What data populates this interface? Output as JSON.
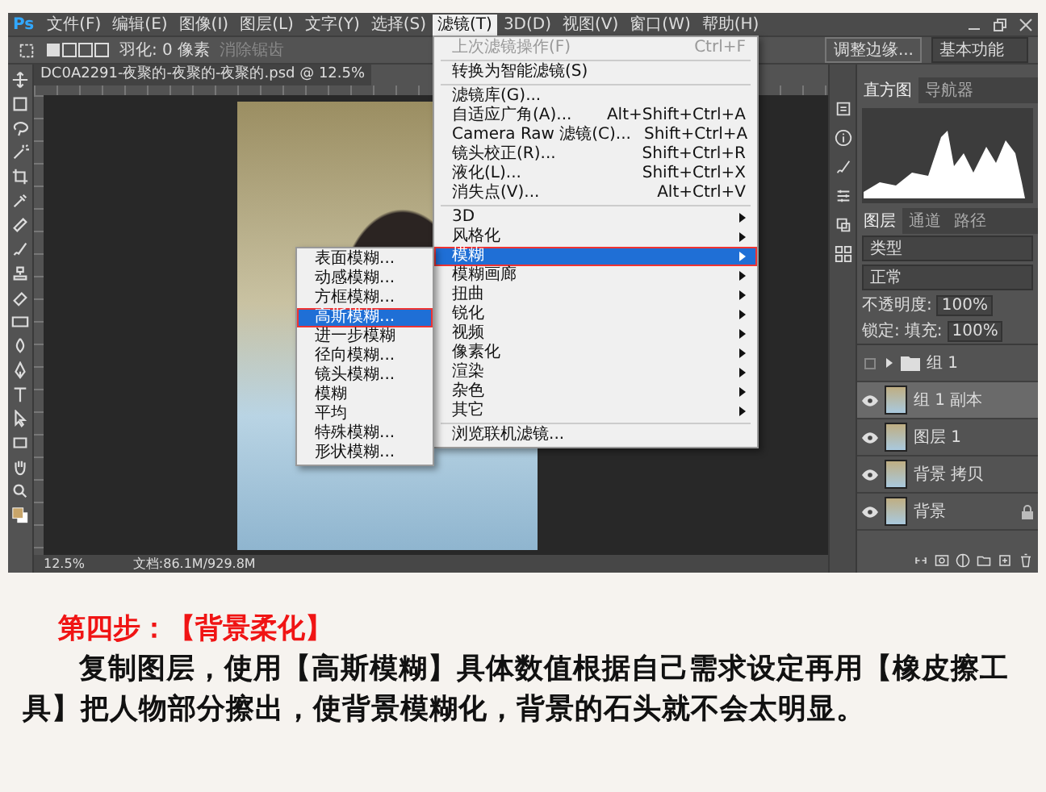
{
  "menu_bar": {
    "logo": "Ps",
    "items": [
      {
        "label": "文件(F)",
        "selected": false
      },
      {
        "label": "编辑(E)",
        "selected": false
      },
      {
        "label": "图像(I)",
        "selected": false
      },
      {
        "label": "图层(L)",
        "selected": false
      },
      {
        "label": "文字(Y)",
        "selected": false
      },
      {
        "label": "选择(S)",
        "selected": false
      },
      {
        "label": "滤镜(T)",
        "selected": true
      },
      {
        "label": "3D(D)",
        "selected": false
      },
      {
        "label": "视图(V)",
        "selected": false
      },
      {
        "label": "窗口(W)",
        "selected": false
      },
      {
        "label": "帮助(H)",
        "selected": false
      }
    ]
  },
  "options_bar": {
    "feather": "羽化: 0 像素",
    "antialias": {
      "label": "消除锯齿",
      "disabled": true
    },
    "refine_edge": "调整边缘...",
    "workspace": "基本功能"
  },
  "document_tab": {
    "title": "DC0A2291-夜聚的-夜聚的-夜聚的.psd @ 12.5%"
  },
  "filter_menu": {
    "sections": [
      [
        {
          "label": "上次滤镜操作(F)",
          "shortcut": "Ctrl+F",
          "submenu": false,
          "disabled": true,
          "selected": false
        }
      ],
      [
        {
          "label": "转换为智能滤镜(S)",
          "submenu": false,
          "disabled": false,
          "selected": false
        }
      ],
      [
        {
          "label": "滤镜库(G)...",
          "submenu": false,
          "disabled": false,
          "selected": false
        },
        {
          "label": "自适应广角(A)...",
          "shortcut": "Alt+Shift+Ctrl+A",
          "submenu": false,
          "disabled": false,
          "selected": false
        },
        {
          "label": "Camera Raw 滤镜(C)...",
          "shortcut": "Shift+Ctrl+A",
          "submenu": false,
          "disabled": false,
          "selected": false
        },
        {
          "label": "镜头校正(R)...",
          "shortcut": "Shift+Ctrl+R",
          "submenu": false,
          "disabled": false,
          "selected": false
        },
        {
          "label": "液化(L)...",
          "shortcut": "Shift+Ctrl+X",
          "submenu": false,
          "disabled": false,
          "selected": false
        },
        {
          "label": "消失点(V)...",
          "shortcut": "Alt+Ctrl+V",
          "submenu": false,
          "disabled": false,
          "selected": false
        }
      ],
      [
        {
          "label": "3D",
          "submenu": true,
          "disabled": false,
          "selected": false
        },
        {
          "label": "风格化",
          "submenu": true,
          "disabled": false,
          "selected": false
        },
        {
          "label": "模糊",
          "submenu": true,
          "disabled": false,
          "selected": true
        },
        {
          "label": "模糊画廊",
          "submenu": true,
          "disabled": false,
          "selected": false
        },
        {
          "label": "扭曲",
          "submenu": true,
          "disabled": false,
          "selected": false
        },
        {
          "label": "锐化",
          "submenu": true,
          "disabled": false,
          "selected": false
        },
        {
          "label": "视频",
          "submenu": true,
          "disabled": false,
          "selected": false
        },
        {
          "label": "像素化",
          "submenu": true,
          "disabled": false,
          "selected": false
        },
        {
          "label": "渲染",
          "submenu": true,
          "disabled": false,
          "selected": false
        },
        {
          "label": "杂色",
          "submenu": true,
          "disabled": false,
          "selected": false
        },
        {
          "label": "其它",
          "submenu": true,
          "disabled": false,
          "selected": false
        }
      ],
      [
        {
          "label": "浏览联机滤镜...",
          "submenu": false,
          "disabled": false,
          "selected": false
        }
      ]
    ]
  },
  "blur_submenu": {
    "items": [
      {
        "label": "表面模糊...",
        "selected": false
      },
      {
        "label": "动感模糊...",
        "selected": false
      },
      {
        "label": "方框模糊...",
        "selected": false
      },
      {
        "label": "高斯模糊...",
        "selected": true
      },
      {
        "label": "进一步模糊",
        "selected": false
      },
      {
        "label": "径向模糊...",
        "selected": false
      },
      {
        "label": "镜头模糊...",
        "selected": false
      },
      {
        "label": "模糊",
        "selected": false
      },
      {
        "label": "平均",
        "selected": false
      },
      {
        "label": "特殊模糊...",
        "selected": false
      },
      {
        "label": "形状模糊...",
        "selected": false
      }
    ]
  },
  "status_bar": {
    "zoom": "12.5%",
    "doc_size": "文档:86.1M/929.8M"
  },
  "histogram_panel": {
    "tabs": [
      {
        "label": "直方图",
        "selected": true
      },
      {
        "label": "导航器",
        "selected": false
      }
    ]
  },
  "layers_panel": {
    "tabs": [
      {
        "label": "图层",
        "selected": true
      },
      {
        "label": "通道",
        "selected": false
      },
      {
        "label": "路径",
        "selected": false
      }
    ],
    "filter": "类型",
    "blend_mode": "正常",
    "opacity_label": "不透明度:",
    "opacity": "100%",
    "lock_label": "锁定:",
    "fill_label": "填充:",
    "fill": "100%",
    "layers": [
      {
        "kind": "group",
        "name": "组 1",
        "visible": false,
        "expanded": false,
        "selected": false,
        "locked": false
      },
      {
        "kind": "layer",
        "name": "组 1 副本",
        "visible": true,
        "selected": true,
        "locked": false
      },
      {
        "kind": "layer",
        "name": "图层 1",
        "visible": true,
        "selected": false,
        "locked": false
      },
      {
        "kind": "layer",
        "name": "背景 拷贝",
        "visible": true,
        "selected": false,
        "locked": false
      },
      {
        "kind": "layer",
        "name": "背景",
        "visible": true,
        "selected": false,
        "locked": true
      }
    ]
  },
  "caption": {
    "title": "第四步：【背景柔化】",
    "body": "复制图层，使用【高斯模糊】具体数值根据自己需求设定再用【橡皮擦工具】把人物部分擦出，使背景模糊化，背景的石头就不会太明显。"
  }
}
